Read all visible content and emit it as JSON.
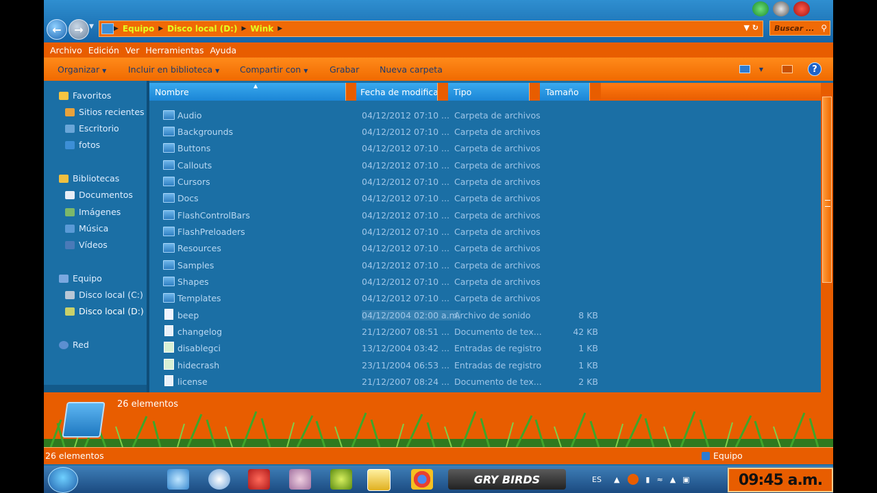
{
  "address": {
    "crumbs": [
      "Equipo",
      "Disco local (D:)",
      "Wink"
    ],
    "search_placeholder": "Buscar ..."
  },
  "menu": [
    "Archivo",
    "Edición",
    "Ver",
    "Herramientas",
    "Ayuda"
  ],
  "toolbar": {
    "organize": "Organizar",
    "include_library": "Incluir en biblioteca",
    "share": "Compartir con",
    "burn": "Grabar",
    "new_folder": "Nueva carpeta"
  },
  "nav": {
    "favorites": "Favoritos",
    "recent": "Sitios recientes",
    "desktop": "Escritorio",
    "photos": "fotos",
    "libraries": "Bibliotecas",
    "documents": "Documentos",
    "images": "Imágenes",
    "music": "Música",
    "videos": "Vídeos",
    "computer": "Equipo",
    "disk_c": "Disco local (C:)",
    "disk_d": "Disco local (D:)",
    "network": "Red"
  },
  "columns": {
    "name": "Nombre",
    "date": "Fecha de modifica...",
    "type": "Tipo",
    "size": "Tamaño"
  },
  "files": [
    {
      "name": "Audio",
      "date": "04/12/2012 07:10 ...",
      "type": "Carpeta de archivos",
      "size": "",
      "icon": "folder-icon"
    },
    {
      "name": "Backgrounds",
      "date": "04/12/2012 07:10 ...",
      "type": "Carpeta de archivos",
      "size": "",
      "icon": "folder-icon"
    },
    {
      "name": "Buttons",
      "date": "04/12/2012 07:10 ...",
      "type": "Carpeta de archivos",
      "size": "",
      "icon": "folder-icon"
    },
    {
      "name": "Callouts",
      "date": "04/12/2012 07:10 ...",
      "type": "Carpeta de archivos",
      "size": "",
      "icon": "folder-icon"
    },
    {
      "name": "Cursors",
      "date": "04/12/2012 07:10 ...",
      "type": "Carpeta de archivos",
      "size": "",
      "icon": "folder-icon"
    },
    {
      "name": "Docs",
      "date": "04/12/2012 07:10 ...",
      "type": "Carpeta de archivos",
      "size": "",
      "icon": "folder-icon"
    },
    {
      "name": "FlashControlBars",
      "date": "04/12/2012 07:10 ...",
      "type": "Carpeta de archivos",
      "size": "",
      "icon": "folder-icon"
    },
    {
      "name": "FlashPreloaders",
      "date": "04/12/2012 07:10 ...",
      "type": "Carpeta de archivos",
      "size": "",
      "icon": "folder-icon"
    },
    {
      "name": "Resources",
      "date": "04/12/2012 07:10 ...",
      "type": "Carpeta de archivos",
      "size": "",
      "icon": "folder-icon"
    },
    {
      "name": "Samples",
      "date": "04/12/2012 07:10 ...",
      "type": "Carpeta de archivos",
      "size": "",
      "icon": "folder-icon"
    },
    {
      "name": "Shapes",
      "date": "04/12/2012 07:10 ...",
      "type": "Carpeta de archivos",
      "size": "",
      "icon": "folder-icon"
    },
    {
      "name": "Templates",
      "date": "04/12/2012 07:10 ...",
      "type": "Carpeta de archivos",
      "size": "",
      "icon": "folder-icon"
    },
    {
      "name": "beep",
      "date": "04/12/2004 02:00 a.m.",
      "type": "Archivo de sonido",
      "size": "8 KB",
      "icon": "sound-file-icon"
    },
    {
      "name": "changelog",
      "date": "21/12/2007 08:51 ...",
      "type": "Documento de tex...",
      "size": "42 KB",
      "icon": "text-file-icon"
    },
    {
      "name": "disablegci",
      "date": "13/12/2004 03:42 ...",
      "type": "Entradas de registro",
      "size": "1 KB",
      "icon": "registry-file-icon"
    },
    {
      "name": "hidecrash",
      "date": "23/11/2004 06:53 ...",
      "type": "Entradas de registro",
      "size": "1 KB",
      "icon": "registry-file-icon"
    },
    {
      "name": "license",
      "date": "21/12/2007 08:24 ...",
      "type": "Documento de tex...",
      "size": "2 KB",
      "icon": "text-file-icon"
    }
  ],
  "details": {
    "count": "26 elementos"
  },
  "status": {
    "left": "26 elementos",
    "right": "Equipo"
  },
  "tray": {
    "lang": "ES",
    "clock": "09:45 a.m."
  },
  "taskbar": {
    "game_label": "GRY BIRDS"
  },
  "colors": {
    "accent": "#e85d00",
    "pane": "#1b6fa5",
    "address_text": "#e4ff20"
  }
}
